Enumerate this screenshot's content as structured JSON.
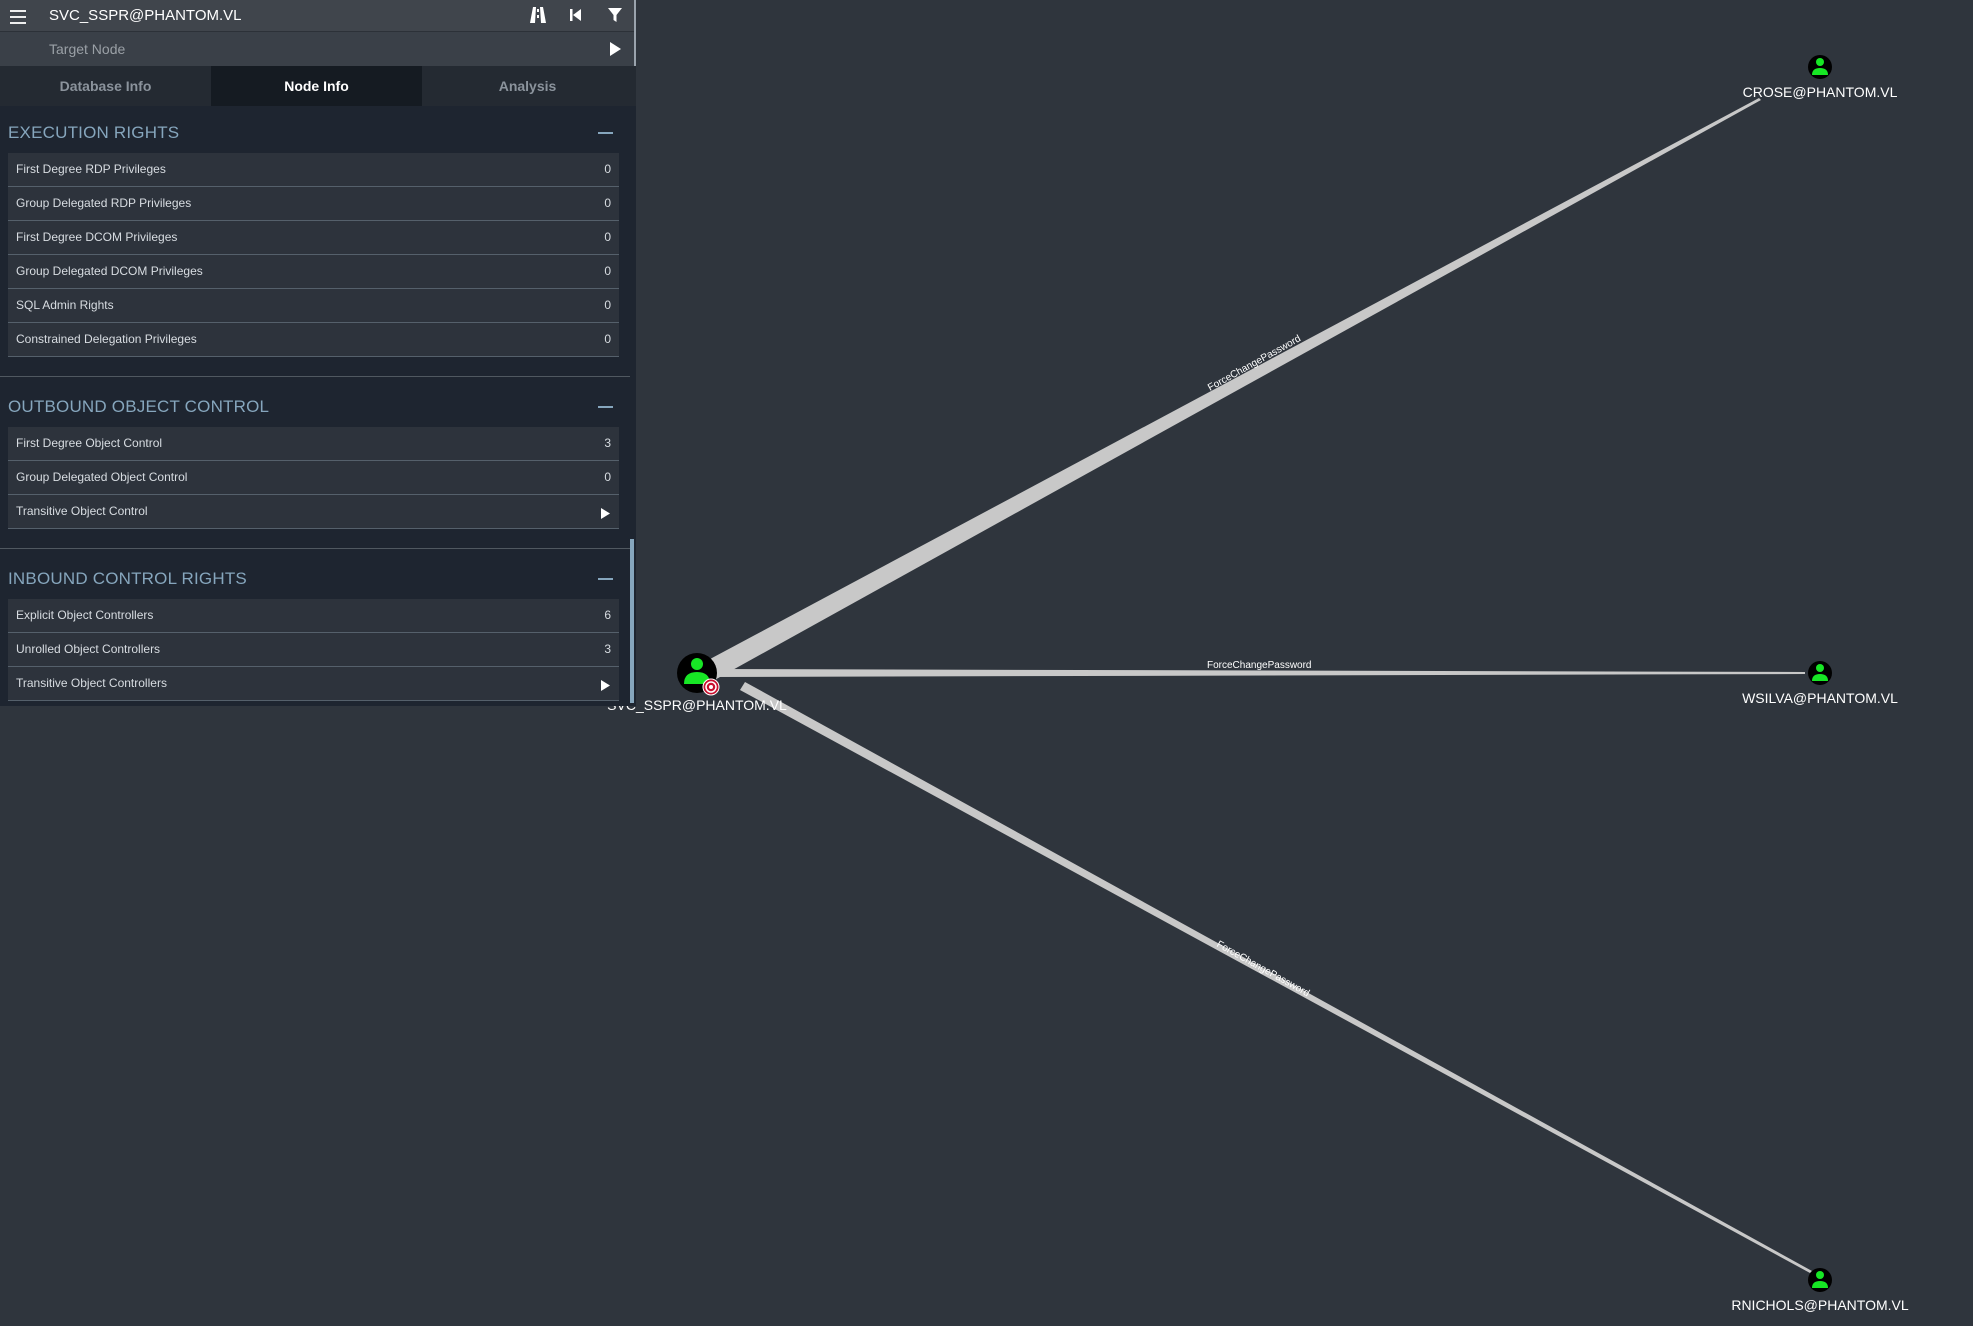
{
  "header": {
    "title": "SVC_SSPR@PHANTOM.VL",
    "target_placeholder": "Target Node"
  },
  "tabs": [
    {
      "label": "Database Info",
      "active": false
    },
    {
      "label": "Node Info",
      "active": true
    },
    {
      "label": "Analysis",
      "active": false
    }
  ],
  "sections": [
    {
      "title": "EXECUTION RIGHTS",
      "rows": [
        {
          "label": "First Degree RDP Privileges",
          "value": "0"
        },
        {
          "label": "Group Delegated RDP Privileges",
          "value": "0"
        },
        {
          "label": "First Degree DCOM Privileges",
          "value": "0"
        },
        {
          "label": "Group Delegated DCOM Privileges",
          "value": "0"
        },
        {
          "label": "SQL Admin Rights",
          "value": "0"
        },
        {
          "label": "Constrained Delegation Privileges",
          "value": "0"
        }
      ]
    },
    {
      "title": "OUTBOUND OBJECT CONTROL",
      "rows": [
        {
          "label": "First Degree Object Control",
          "value": "3"
        },
        {
          "label": "Group Delegated Object Control",
          "value": "0"
        },
        {
          "label": "Transitive Object Control",
          "value": ""
        }
      ]
    },
    {
      "title": "INBOUND CONTROL RIGHTS",
      "rows": [
        {
          "label": "Explicit Object Controllers",
          "value": "6"
        },
        {
          "label": "Unrolled Object Controllers",
          "value": "3"
        },
        {
          "label": "Transitive Object Controllers",
          "value": ""
        }
      ]
    }
  ],
  "graph": {
    "nodes": {
      "source": "SVC_SSPR@PHANTOM.VL",
      "crose": "CROSE@PHANTOM.VL",
      "wsilva": "WSILVA@PHANTOM.VL",
      "rnichols": "RNICHOLS@PHANTOM.VL"
    },
    "edges": {
      "to_crose": "ForceChangePassword",
      "to_wsilva": "ForceChangePassword",
      "to_rnichols": "ForceChangePassword"
    }
  },
  "colors": {
    "background": "#2f353d",
    "panel": "#1e2530",
    "accent": "#86a6bd",
    "user_node": "#17e625",
    "target_badge": "#c8102e",
    "edge": "#c8c8c8"
  },
  "icons": {
    "menu": "hamburger-icon",
    "pathfinding": "road-icon",
    "back": "skip-back-icon",
    "filter": "filter-icon",
    "play": "play-icon",
    "user": "user-icon",
    "target": "target-icon"
  }
}
